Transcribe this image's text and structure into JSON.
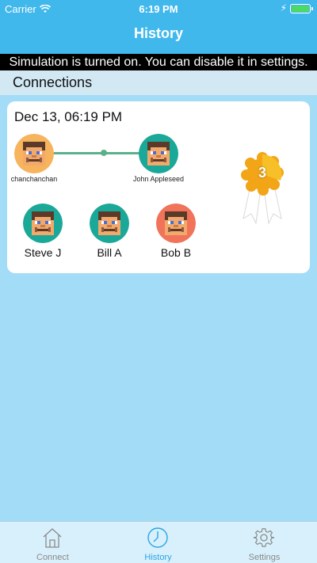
{
  "status_bar": {
    "carrier": "Carrier",
    "time": "6:19 PM"
  },
  "nav": {
    "title": "History"
  },
  "banner": {
    "text": "Simulation is turned on. You can disable it in settings."
  },
  "section": {
    "title": "Connections"
  },
  "card": {
    "date": "Dec 13, 06:19 PM",
    "connection": {
      "from": {
        "name": "chanchanchan",
        "bg": "#f6b45d"
      },
      "to": {
        "name": "John Appleseed",
        "bg": "#1aa898"
      }
    },
    "badge_count": "3",
    "people": [
      {
        "name": "Steve J",
        "bg": "#1aa898"
      },
      {
        "name": "Bill A",
        "bg": "#1aa898"
      },
      {
        "name": "Bob B",
        "bg": "#f0735a"
      }
    ]
  },
  "tabs": [
    {
      "label": "Connect",
      "icon": "home-icon",
      "active": false
    },
    {
      "label": "History",
      "icon": "clock-icon",
      "active": true
    },
    {
      "label": "Settings",
      "icon": "gear-icon",
      "active": false
    }
  ],
  "colors": {
    "header": "#41b8ec",
    "background": "#a3dcf7",
    "active_tab": "#2aa6e6",
    "connection_line": "#5bb08b"
  }
}
